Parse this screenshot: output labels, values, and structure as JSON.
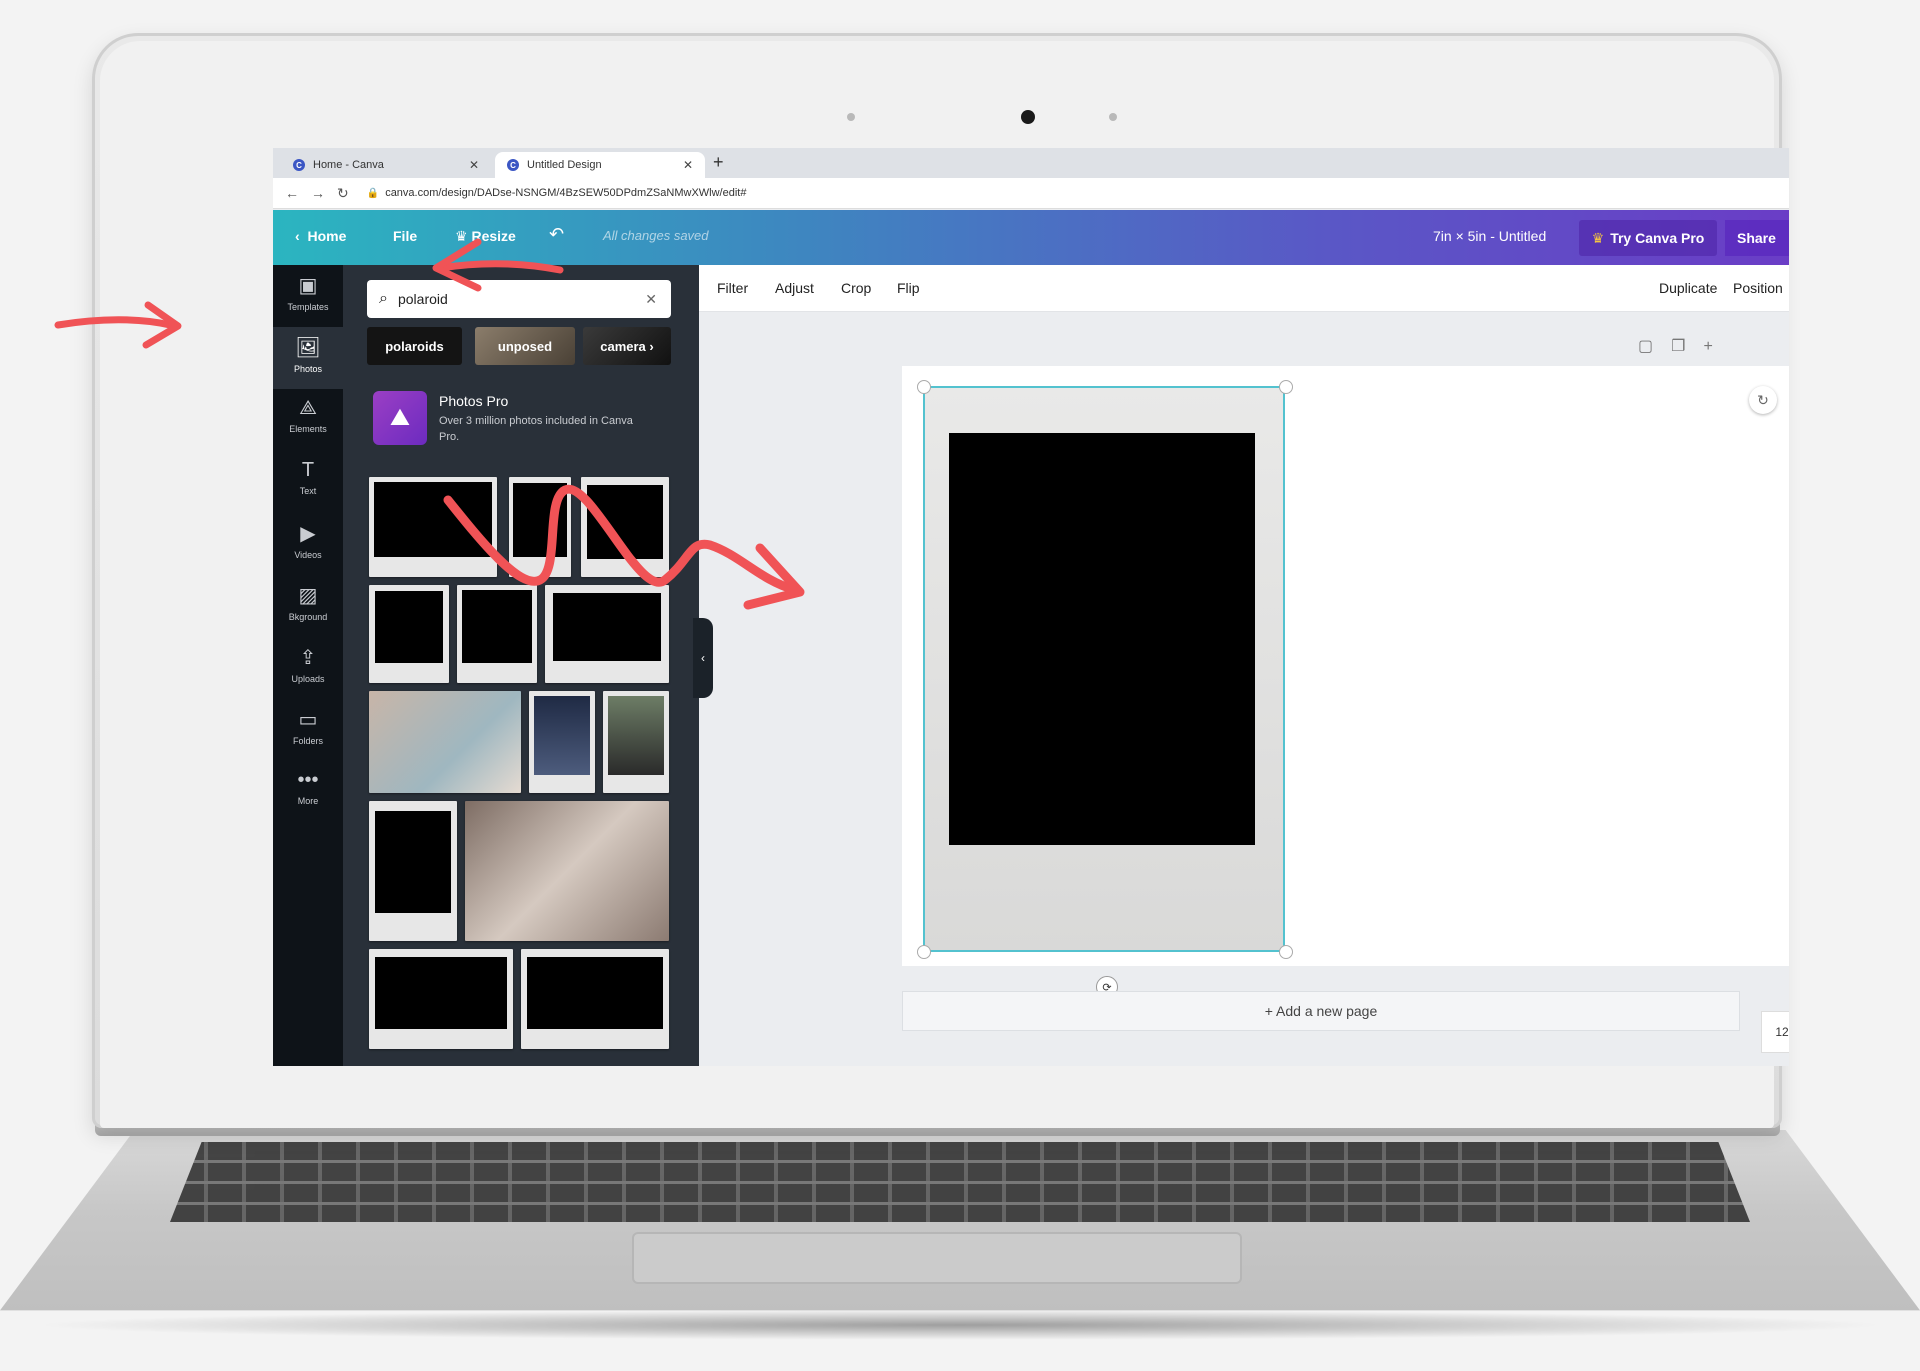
{
  "browser": {
    "tabs": [
      {
        "label": "Home - Canva",
        "favicon": "C"
      },
      {
        "label": "Untitled Design",
        "favicon": "C"
      }
    ],
    "url": "canva.com/design/DADse-NSNGM/4BzSEW50DPdmZSaNMwXWlw/edit#"
  },
  "topbar": {
    "home": "Home",
    "file": "File",
    "resize": "Resize",
    "status": "All changes saved",
    "dims": "7in × 5in - Untitled",
    "try_pro": "Try Canva Pro",
    "share": "Share"
  },
  "rail": {
    "items": [
      {
        "label": "Templates",
        "icon": "▣"
      },
      {
        "label": "Photos",
        "icon": "🖼"
      },
      {
        "label": "Elements",
        "icon": "⟁"
      },
      {
        "label": "Text",
        "icon": "T"
      },
      {
        "label": "Videos",
        "icon": "▶"
      },
      {
        "label": "Bkground",
        "icon": "▨"
      },
      {
        "label": "Uploads",
        "icon": "⇪"
      },
      {
        "label": "Folders",
        "icon": "▭"
      },
      {
        "label": "More",
        "icon": "•••"
      }
    ]
  },
  "panel": {
    "search_value": "polaroid",
    "chips": [
      "polaroids",
      "unposed",
      "camera"
    ],
    "pro_title": "Photos Pro",
    "pro_desc": "Over 3 million photos included in Canva Pro."
  },
  "toolbar": {
    "filter": "Filter",
    "adjust": "Adjust",
    "crop": "Crop",
    "flip": "Flip",
    "duplicate": "Duplicate",
    "position": "Position"
  },
  "canvas": {
    "add_page": "+ Add a new page",
    "zoom": "12"
  },
  "colors": {
    "accent_gradient_start": "#2bb5c0",
    "accent_gradient_end": "#6a3dc6",
    "annotation_arrow": "#f05356",
    "selection": "#53c2cf"
  }
}
